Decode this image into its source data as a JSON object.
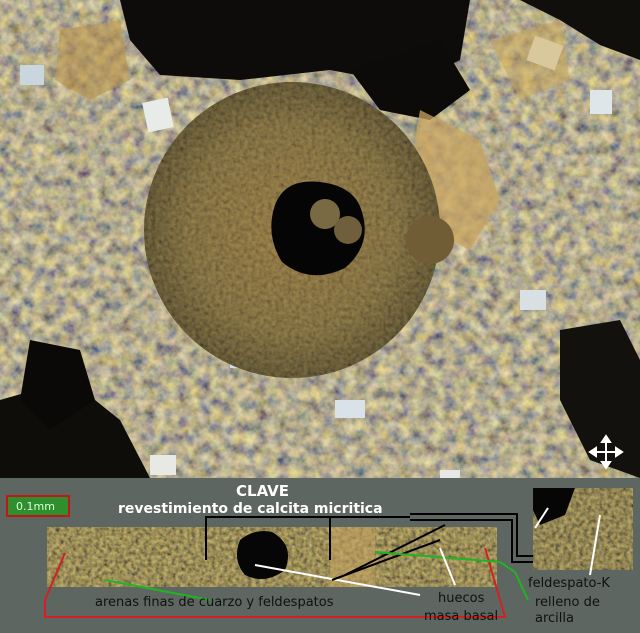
{
  "scale": {
    "label": "0.1mm"
  },
  "legend": {
    "title": "CLAVE",
    "coating": "revestimiento de calcita micritica",
    "sands": "arenas finas de cuarzo y feldespatos",
    "voids": "huecos",
    "matrix": "masa basal",
    "k_feldspar": "feldespato-K",
    "clay_fill": "relleno de arcilla"
  },
  "colors": {
    "background": "#5d6660",
    "line_red": "#d42020",
    "line_green": "#21b421",
    "line_white": "#ffffff",
    "line_black": "#000000"
  },
  "icons": {
    "orientation": "cross-arrows-icon"
  }
}
